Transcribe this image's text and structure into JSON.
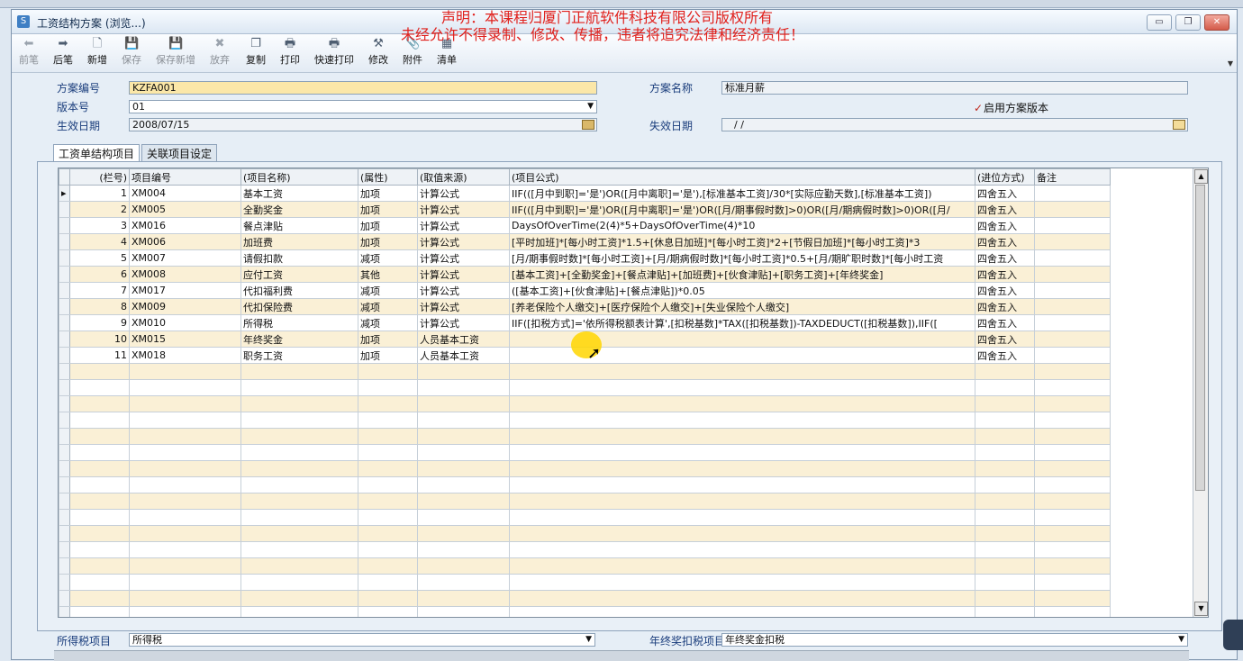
{
  "window": {
    "title": "工资结构方案 (浏览...)",
    "min": "▭",
    "max": "❐",
    "close": "✕"
  },
  "watermark": {
    "line1": "声明：本课程归厦门正航软件科技有限公司版权所有",
    "line2": "未经允许不得录制、修改、传播，违者将追究法律和经济责任！"
  },
  "toolbar": [
    {
      "label": "前笔",
      "icon": "arrow-left-icon",
      "glyph": "⬅",
      "enabled": false
    },
    {
      "label": "后笔",
      "icon": "arrow-right-icon",
      "glyph": "➡",
      "enabled": true
    },
    {
      "label": "新增",
      "icon": "new-doc-icon",
      "glyph": "🗋",
      "enabled": true
    },
    {
      "label": "保存",
      "icon": "save-icon",
      "glyph": "💾",
      "enabled": false
    },
    {
      "label": "保存新增",
      "icon": "save-new-icon",
      "glyph": "💾",
      "enabled": false
    },
    {
      "label": "放弃",
      "icon": "cancel-icon",
      "glyph": "✖",
      "enabled": false
    },
    {
      "label": "复制",
      "icon": "copy-icon",
      "glyph": "❐",
      "enabled": true
    },
    {
      "label": "打印",
      "icon": "print-icon",
      "glyph": "🖶",
      "enabled": true
    },
    {
      "label": "快速打印",
      "icon": "quick-print-icon",
      "glyph": "🖶",
      "enabled": true
    },
    {
      "label": "修改",
      "icon": "edit-icon",
      "glyph": "⚒",
      "enabled": true
    },
    {
      "label": "附件",
      "icon": "attachment-icon",
      "glyph": "📎",
      "enabled": true
    },
    {
      "label": "清单",
      "icon": "list-icon",
      "glyph": "▦",
      "enabled": true
    }
  ],
  "form": {
    "plan_no_label": "方案编号",
    "plan_no": "KZFA001",
    "version_label": "版本号",
    "version": "01",
    "effective_label": "生效日期",
    "effective": "2008/07/15",
    "plan_name_label": "方案名称",
    "plan_name": "标准月薪",
    "enable_version_label": "启用方案版本",
    "expire_label": "失效日期",
    "expire": "/ /"
  },
  "tabs": [
    "工资单结构项目",
    "关联项目设定"
  ],
  "table": {
    "headers": [
      "(栏号)",
      "项目编号",
      "(项目名称)",
      "(属性)",
      "(取值来源)",
      "(项目公式)",
      "(进位方式)",
      "备注"
    ],
    "rows": [
      [
        "1",
        "XM004",
        "基本工资",
        "加项",
        "计算公式",
        "IIF(([月中到职]='是')OR([月中离职]='是'),[标准基本工资]/30*[实际应勤天数],[标准基本工资])",
        "四舍五入",
        ""
      ],
      [
        "2",
        "XM005",
        "全勤奖金",
        "加项",
        "计算公式",
        "IIF(([月中到职]='是')OR([月中离职]='是')OR([月/期事假时数]>0)OR([月/期病假时数]>0)OR([月/",
        "四舍五入",
        ""
      ],
      [
        "3",
        "XM016",
        "餐点津贴",
        "加项",
        "计算公式",
        "DaysOfOverTime(2(4)*5+DaysOfOverTime(4)*10",
        "四舍五入",
        ""
      ],
      [
        "4",
        "XM006",
        "加班费",
        "加项",
        "计算公式",
        "[平时加班]*[每小时工资]*1.5+[休息日加班]*[每小时工资]*2+[节假日加班]*[每小时工资]*3",
        "四舍五入",
        ""
      ],
      [
        "5",
        "XM007",
        "请假扣款",
        "减项",
        "计算公式",
        "[月/期事假时数]*[每小时工资]+[月/期病假时数]*[每小时工资]*0.5+[月/期旷职时数]*[每小时工资",
        "四舍五入",
        ""
      ],
      [
        "6",
        "XM008",
        "应付工资",
        "其他",
        "计算公式",
        "[基本工资]+[全勤奖金]+[餐点津贴]+[加班费]+[伙食津贴]+[职务工资]+[年终奖金]",
        "四舍五入",
        ""
      ],
      [
        "7",
        "XM017",
        "代扣福利费",
        "减项",
        "计算公式",
        "([基本工资]+[伙食津贴]+[餐点津贴])*0.05",
        "四舍五入",
        ""
      ],
      [
        "8",
        "XM009",
        "代扣保险费",
        "减项",
        "计算公式",
        "[养老保险个人缴交]+[医疗保险个人缴交]+[失业保险个人缴交]",
        "四舍五入",
        ""
      ],
      [
        "9",
        "XM010",
        "所得税",
        "减项",
        "计算公式",
        "IIF([扣税方式]='依所得税额表计算',[扣税基数]*TAX([扣税基数])-TAXDEDUCT([扣税基数]),IIF([",
        "四舍五入",
        ""
      ],
      [
        "10",
        "XM015",
        "年终奖金",
        "加项",
        "人员基本工资",
        "",
        "四舍五入",
        ""
      ],
      [
        "11",
        "XM018",
        "职务工资",
        "加项",
        "人员基本工资",
        "",
        "四舍五入",
        ""
      ]
    ],
    "empty_rows": 16
  },
  "bottom": {
    "income_tax_label": "所得税项目",
    "income_tax": "所得税",
    "year_end_label": "年终奖扣税项目",
    "year_end": "年终奖金扣税"
  },
  "colors": {
    "accent": "#1a3d7c",
    "row_alt": "#faf0d6",
    "watermark": "#e0201c",
    "highlight": "#fbe7a8"
  }
}
